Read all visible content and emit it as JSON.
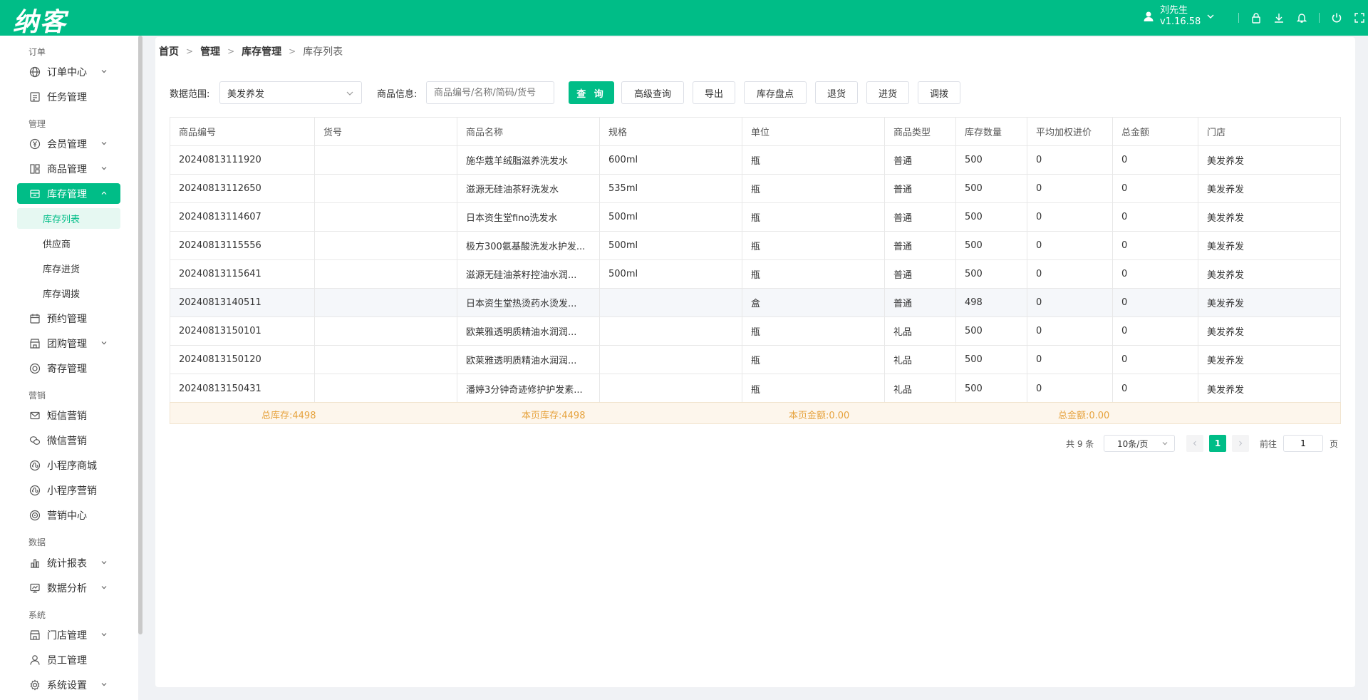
{
  "header": {
    "logo": "纳客",
    "user_name": "刘先生",
    "version": "v1.16.58",
    "icons": [
      "user-icon",
      "lock-icon",
      "download-icon",
      "bell-icon",
      "power-icon",
      "fullscreen-icon"
    ]
  },
  "sidebar": {
    "groups": {
      "order": "订单",
      "manage": "管理",
      "marketing": "营销",
      "data": "数据",
      "system": "系统"
    },
    "items": {
      "order_center": "订单中心",
      "task_manage": "任务管理",
      "member_manage": "会员管理",
      "goods_manage": "商品管理",
      "stock_manage": "库存管理",
      "stock_list": "库存列表",
      "supplier": "供应商",
      "stock_in": "库存进货",
      "stock_transfer": "库存调拨",
      "booking_manage": "预约管理",
      "group_manage": "团购管理",
      "deposit_manage": "寄存管理",
      "sms_marketing": "短信营销",
      "wechat_marketing": "微信营销",
      "mini_mall": "小程序商城",
      "mini_marketing": "小程序营销",
      "marketing_center": "营销中心",
      "stats_report": "统计报表",
      "data_analysis": "数据分析",
      "store_manage": "门店管理",
      "staff_manage": "员工管理",
      "system_settings": "系统设置"
    }
  },
  "breadcrumb": [
    "首页",
    "管理",
    "库存管理",
    "库存列表"
  ],
  "filter": {
    "range_label": "数据范围:",
    "range_value": "美发养发",
    "goods_label": "商品信息:",
    "goods_placeholder": "商品编号/名称/简码/货号",
    "buttons": {
      "query": "查 询",
      "advanced": "高级查询",
      "export": "导出",
      "stocktake": "库存盘点",
      "return": "退货",
      "purchase": "进货",
      "transfer": "调拨"
    }
  },
  "table": {
    "columns": [
      "商品编号",
      "货号",
      "商品名称",
      "规格",
      "单位",
      "商品类型",
      "库存数量",
      "平均加权进价",
      "总金额",
      "门店"
    ],
    "rows": [
      [
        "20240813111920",
        "",
        "施华蔻羊绒脂滋养洗发水",
        "600ml",
        "瓶",
        "普通",
        "500",
        "0",
        "0",
        "美发养发"
      ],
      [
        "20240813112650",
        "",
        "滋源无硅油茶籽洗发水",
        "535ml",
        "瓶",
        "普通",
        "500",
        "0",
        "0",
        "美发养发"
      ],
      [
        "20240813114607",
        "",
        "日本资生堂fino洗发水",
        "500ml",
        "瓶",
        "普通",
        "500",
        "0",
        "0",
        "美发养发"
      ],
      [
        "20240813115556",
        "",
        "极方300氨基酸洗发水护发...",
        "500ml",
        "瓶",
        "普通",
        "500",
        "0",
        "0",
        "美发养发"
      ],
      [
        "20240813115641",
        "",
        "滋源无硅油茶籽控油水润...",
        "500ml",
        "瓶",
        "普通",
        "500",
        "0",
        "0",
        "美发养发"
      ],
      [
        "20240813140511",
        "",
        "日本资生堂热烫药水烫发...",
        "",
        "盒",
        "普通",
        "498",
        "0",
        "0",
        "美发养发"
      ],
      [
        "20240813150101",
        "",
        "欧莱雅透明质精油水润润...",
        "",
        "瓶",
        "礼品",
        "500",
        "0",
        "0",
        "美发养发"
      ],
      [
        "20240813150120",
        "",
        "欧莱雅透明质精油水润润...",
        "",
        "瓶",
        "礼品",
        "500",
        "0",
        "0",
        "美发养发"
      ],
      [
        "20240813150431",
        "",
        "潘婷3分钟奇迹修护护发素...",
        "",
        "瓶",
        "礼品",
        "500",
        "0",
        "0",
        "美发养发"
      ]
    ],
    "highlighted_row": 5
  },
  "summary": {
    "total_stock": "总库存:4498",
    "page_stock": "本页库存:4498",
    "page_amount": "本页金额:0.00",
    "total_amount": "总金额:0.00"
  },
  "pagination": {
    "total": "共 9 条",
    "page_size": "10条/页",
    "current": "1",
    "goto_label": "前往",
    "goto_value": "1",
    "page_label": "页"
  },
  "colors": {
    "brand": "#00bd87",
    "summary_text": "#e6a23c"
  }
}
